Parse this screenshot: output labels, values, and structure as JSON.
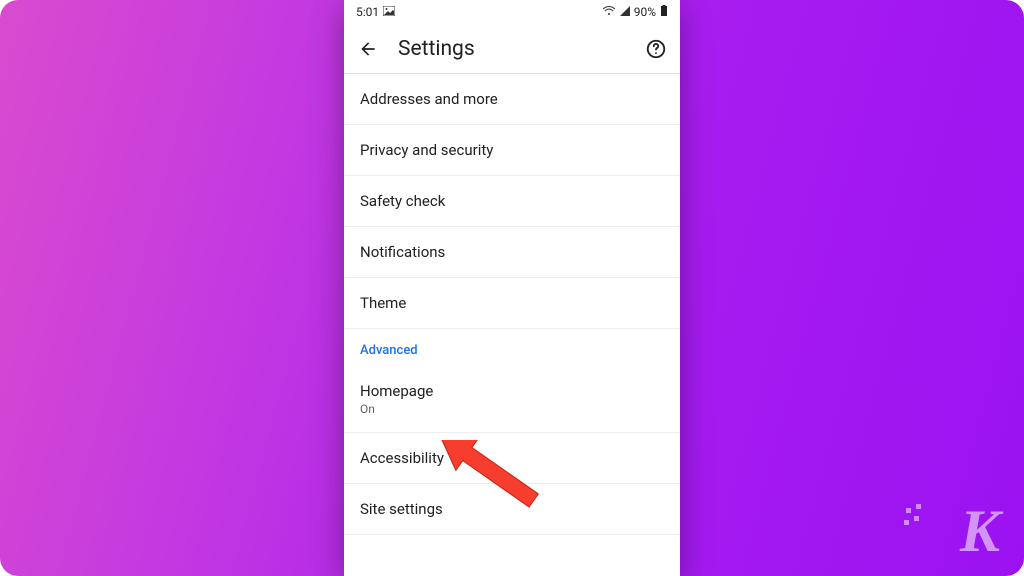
{
  "statusbar": {
    "time": "5:01",
    "battery": "90%"
  },
  "header": {
    "title": "Settings"
  },
  "rows": {
    "addresses": "Addresses and more",
    "privacy": "Privacy and security",
    "safety": "Safety check",
    "notifications": "Notifications",
    "theme": "Theme",
    "advanced_header": "Advanced",
    "homepage": "Homepage",
    "homepage_sub": "On",
    "accessibility": "Accessibility",
    "site_settings": "Site settings"
  }
}
